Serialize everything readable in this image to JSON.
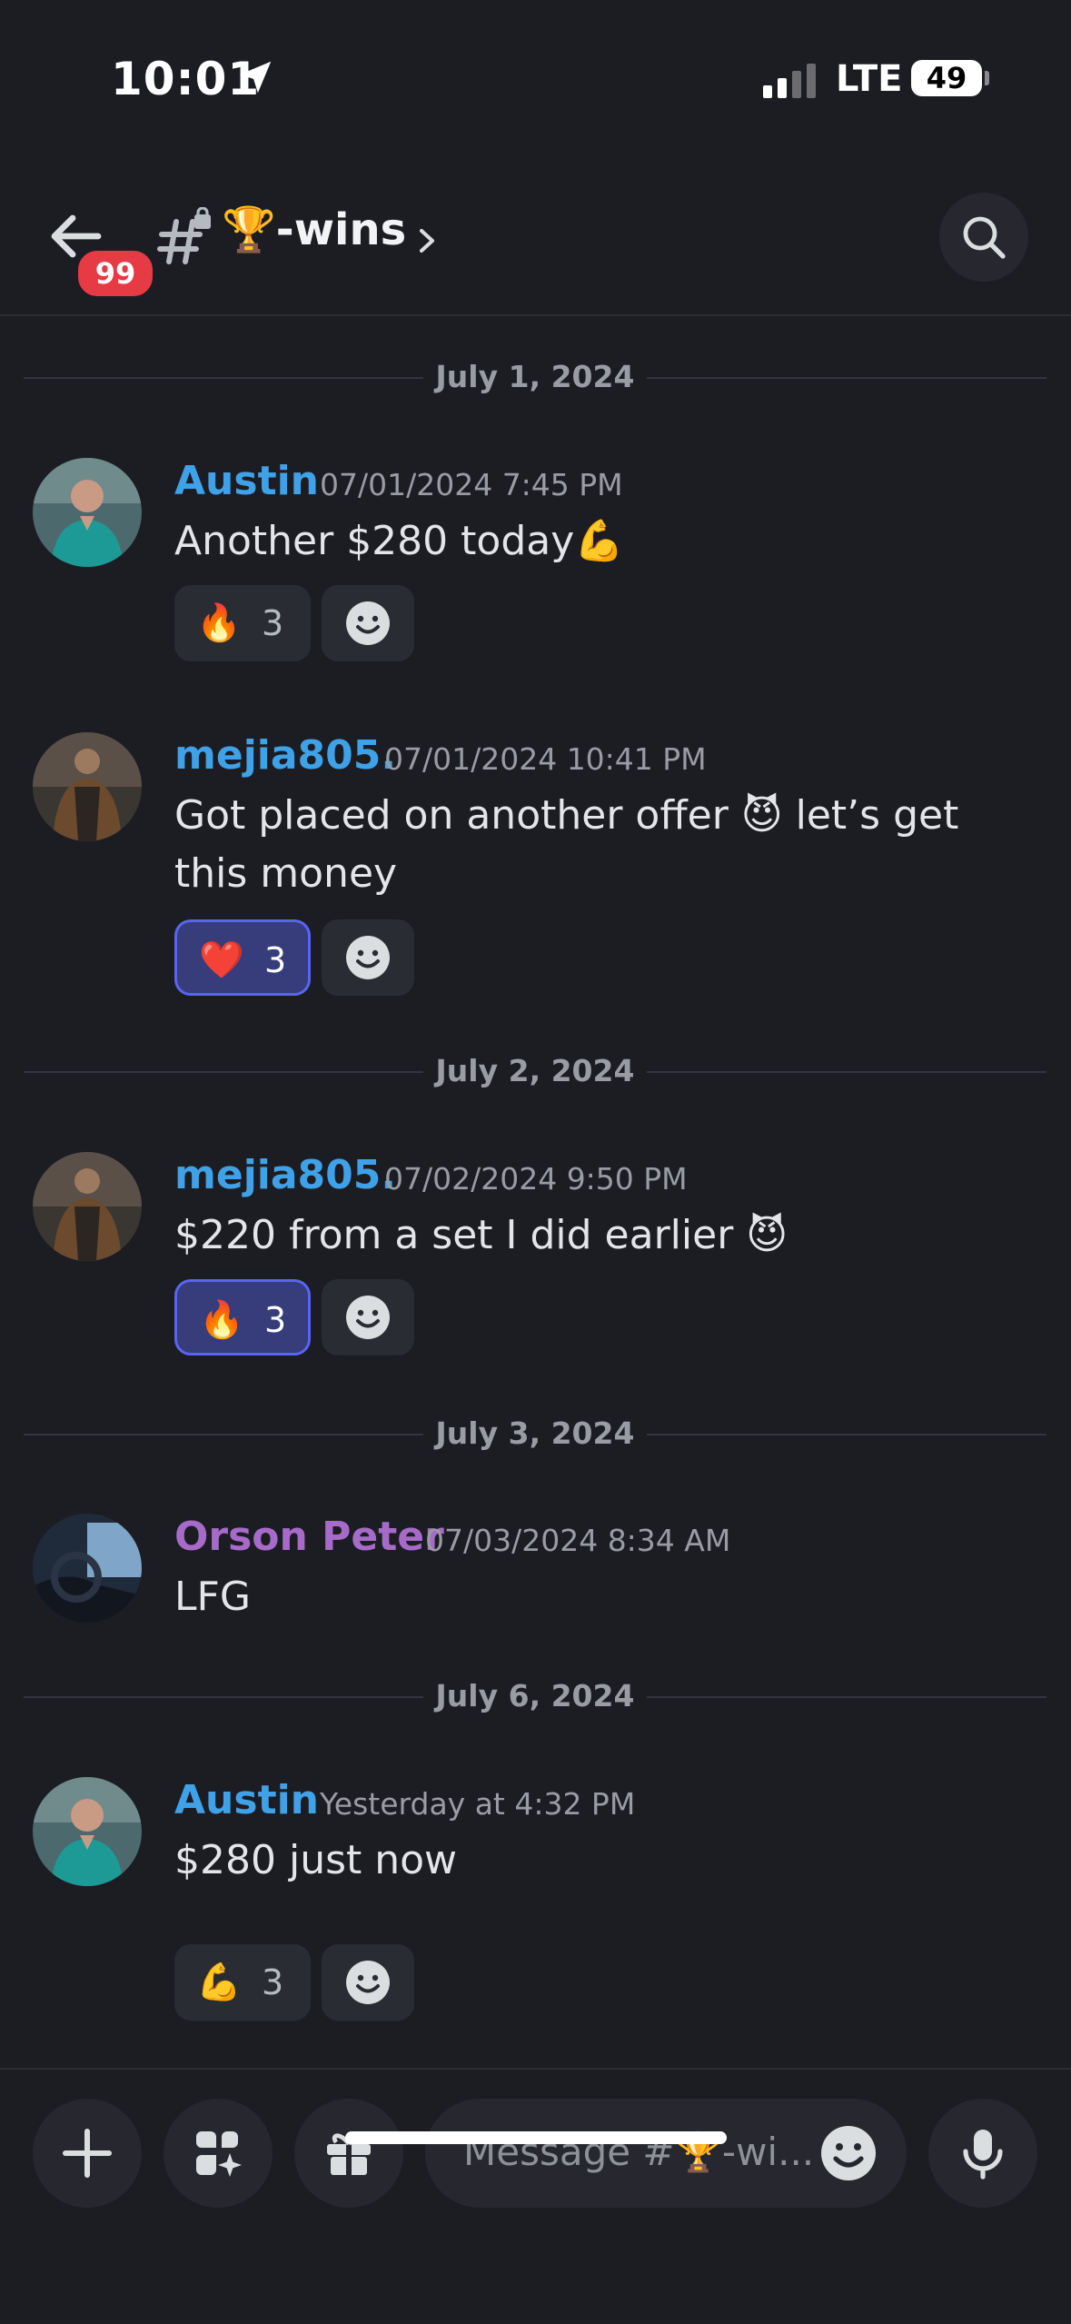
{
  "status": {
    "time": "10:01",
    "network": "LTE",
    "battery": "49"
  },
  "header": {
    "badge": "99",
    "channel": "🏆-wins",
    "chevron": "›"
  },
  "feed": [
    {
      "type": "divider",
      "label": "July 1, 2024"
    },
    {
      "type": "message",
      "author": "Austin",
      "author_color": "#3fa1e8",
      "timestamp": "07/01/2024 7:45 PM",
      "text": "Another $280 today💪",
      "reaction": {
        "emoji": "🔥",
        "count": "3",
        "active": false
      }
    },
    {
      "type": "message",
      "author": "mejia805.",
      "author_color": "#3fa1e8",
      "timestamp": "07/01/2024 10:41 PM",
      "text": "Got placed on another offer 😈 let’s get this money",
      "reaction": {
        "emoji": "❤️",
        "count": "3",
        "active": true
      }
    },
    {
      "type": "divider",
      "label": "July 2, 2024"
    },
    {
      "type": "message",
      "author": "mejia805.",
      "author_color": "#3fa1e8",
      "timestamp": "07/02/2024 9:50 PM",
      "text": "$220 from a set I did earlier 😈",
      "reaction": {
        "emoji": "🔥",
        "count": "3",
        "active": true
      }
    },
    {
      "type": "divider",
      "label": "July 3, 2024"
    },
    {
      "type": "message",
      "author": "Orson Peter",
      "author_color": "#a66bc9",
      "timestamp": "07/03/2024 8:34 AM",
      "text": "LFG"
    },
    {
      "type": "divider",
      "label": "July 6, 2024"
    },
    {
      "type": "message",
      "author": "Austin",
      "author_color": "#3fa1e8",
      "timestamp": "Yesterday at 4:32 PM",
      "text": "$280 just now",
      "reaction": {
        "emoji": "💪",
        "count": "3",
        "active": false
      }
    }
  ],
  "composer": {
    "placeholder": "Message #🏆-wi..."
  },
  "icons": {
    "back": "arrow-left-icon",
    "channel": "locked-hash-icon",
    "search": "search-icon",
    "add": "plus-icon",
    "apps": "apps-icon",
    "gift": "gift-icon",
    "emoji": "smiley-icon",
    "mic": "microphone-icon",
    "add_reaction": "add-reaction-icon"
  }
}
